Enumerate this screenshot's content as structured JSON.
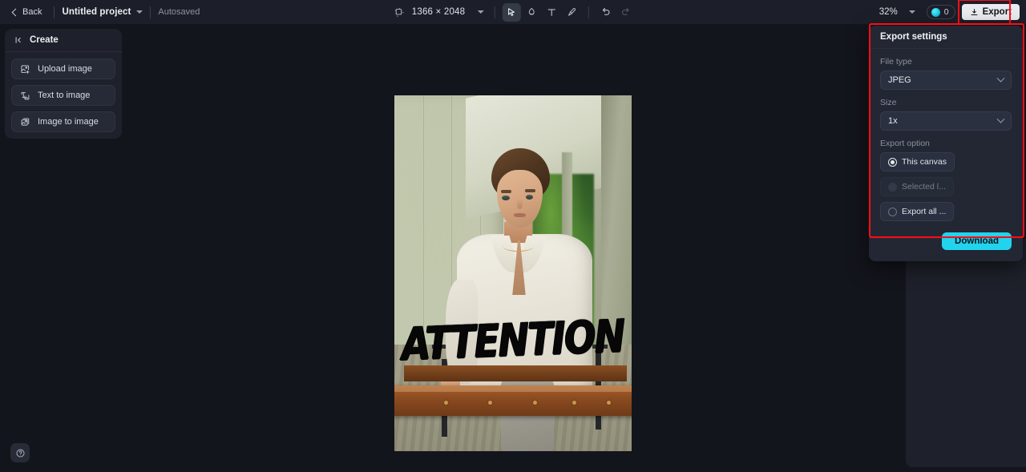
{
  "topbar": {
    "back_label": "Back",
    "project_name": "Untitled project",
    "autosave_status": "Autosaved",
    "canvas_size": "1366 × 2048",
    "zoom_level": "32%",
    "credits_count": "0",
    "export_label": "Export",
    "tools": [
      {
        "name": "select-tool",
        "icon": "cursor-icon",
        "active": true
      },
      {
        "name": "eraser-tool",
        "icon": "eraser-icon",
        "active": false
      },
      {
        "name": "text-tool",
        "icon": "text-icon",
        "active": false
      },
      {
        "name": "brush-tool",
        "icon": "brush-icon",
        "active": false
      },
      {
        "name": "undo",
        "icon": "undo-icon",
        "active": false
      },
      {
        "name": "redo",
        "icon": "redo-icon",
        "active": false
      }
    ]
  },
  "left_panel": {
    "title": "Create",
    "items": [
      {
        "label": "Upload image",
        "icon": "upload-image-icon"
      },
      {
        "label": "Text to image",
        "icon": "text-to-image-icon"
      },
      {
        "label": "Image to image",
        "icon": "image-to-image-icon"
      }
    ]
  },
  "canvas": {
    "overlay_text": "ATTENTION"
  },
  "export_settings": {
    "title": "Export settings",
    "file_type_label": "File type",
    "file_type_value": "JPEG",
    "size_label": "Size",
    "size_value": "1x",
    "export_option_label": "Export option",
    "options": [
      {
        "label": "This canvas",
        "selected": true,
        "disabled": false
      },
      {
        "label": "Selected l...",
        "selected": false,
        "disabled": true
      },
      {
        "label": "Export all ...",
        "selected": false,
        "disabled": false
      }
    ],
    "download_label": "Download"
  },
  "help": {
    "icon": "help-circle-icon"
  },
  "colors": {
    "accent": "#22d3ee",
    "highlight": "#ff0d16",
    "panel_bg": "#1e212b",
    "popover_bg": "#232733",
    "topbar_bg": "#1c1f29",
    "canvas_bg": "#13151c"
  }
}
